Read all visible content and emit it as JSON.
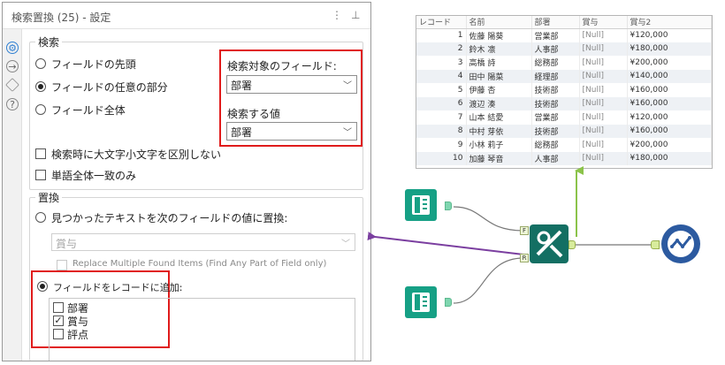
{
  "panel": {
    "title": "検索置換 (25) - 設定",
    "menu_glyph": "⋮",
    "pin_glyph": "⊥",
    "side_icons": [
      "gear-icon",
      "info-icon",
      "tag-icon",
      "help-icon"
    ],
    "search": {
      "legend": "検索",
      "options": [
        {
          "label": "フィールドの先頭",
          "selected": false
        },
        {
          "label": "フィールドの任意の部分",
          "selected": true
        },
        {
          "label": "フィールド全体",
          "selected": false
        }
      ],
      "field_label": "検索対象のフィールド:",
      "field_value": "部署",
      "value_label": "検索する値",
      "value_value": "部署",
      "case_label": "検索時に大文字小文字を区別しない",
      "case_checked": false,
      "whole_word_label": "単語全体一致のみ",
      "whole_word_checked": false
    },
    "replace": {
      "legend": "置換",
      "replace_option_label": "見つかったテキストを次のフィールドの値に置換:",
      "replace_option_selected": false,
      "replace_field_value": "賞与",
      "replace_multiple_label": "Replace Multiple Found Items (Find Any Part of Field only)",
      "append_option_label": "フィールドをレコードに追加:",
      "append_option_selected": true,
      "append_fields": [
        {
          "label": "部署",
          "checked": false
        },
        {
          "label": "賞与",
          "checked": true
        },
        {
          "label": "評点",
          "checked": false
        }
      ]
    }
  },
  "results": {
    "columns": [
      "レコード",
      "名前",
      "部署",
      "賞与",
      "賞与2"
    ],
    "rows": [
      [
        "1",
        "佐藤 陽葵",
        "営業部",
        "[Null]",
        "¥120,000"
      ],
      [
        "2",
        "鈴木 凛",
        "人事部",
        "[Null]",
        "¥180,000"
      ],
      [
        "3",
        "高橋 詩",
        "総務部",
        "[Null]",
        "¥200,000"
      ],
      [
        "4",
        "田中 陽菜",
        "経理部",
        "[Null]",
        "¥140,000"
      ],
      [
        "5",
        "伊藤 杏",
        "技術部",
        "[Null]",
        "¥160,000"
      ],
      [
        "6",
        "渡辺 湊",
        "技術部",
        "[Null]",
        "¥160,000"
      ],
      [
        "7",
        "山本 結愛",
        "営業部",
        "[Null]",
        "¥120,000"
      ],
      [
        "8",
        "中村 芽依",
        "技術部",
        "[Null]",
        "¥160,000"
      ],
      [
        "9",
        "小林 莉子",
        "総務部",
        "[Null]",
        "¥200,000"
      ],
      [
        "10",
        "加藤 琴音",
        "人事部",
        "[Null]",
        "¥180,000"
      ]
    ]
  },
  "canvas": {
    "find_anchor_label": "F",
    "replace_anchor_label": "R",
    "connector_colors": {
      "link_to_panel": "#7b3fa0",
      "to_browse": "#8bc34a",
      "default": "#777777"
    },
    "tool_icons": [
      "input-book-icon",
      "input-book-icon",
      "find-replace-icon",
      "browse-icon"
    ]
  },
  "colors": {
    "highlight": "#e01b1b",
    "accent": "#2f7fd1"
  }
}
